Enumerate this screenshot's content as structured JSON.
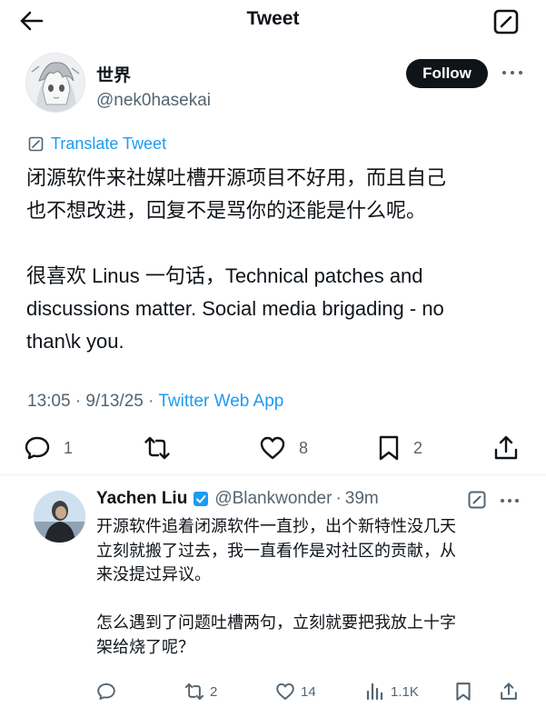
{
  "header": {
    "title": "Tweet"
  },
  "author": {
    "name": "世界",
    "handle": "@nek0hasekai",
    "follow_label": "Follow"
  },
  "translate_label": "Translate Tweet",
  "tweet": {
    "paragraphs": [
      [
        "闭源软件来社媒吐槽开源项目不好用，而且自己",
        "也不想改进，回复不是骂你的还能是什么呢。"
      ],
      [
        "很喜欢 Linus 一句话，Technical patches and",
        "discussions matter. Social media brigading - no",
        "than\\k you."
      ]
    ],
    "time": "13:05 · 9/13/25 · ",
    "source": "Twitter Web App"
  },
  "actions": {
    "replies": "1",
    "retweets": "",
    "likes": "8",
    "bookmarks": "2"
  },
  "reply": {
    "name": "Yachen Liu",
    "handle": "@Blankwonder",
    "separator": "·",
    "time": "39m",
    "paragraphs": [
      [
        "开源软件追着闭源软件一直抄，出个新特性没几天",
        "立刻就搬了过去，我一直看作是对社区的贡献，从",
        "来没提过异议。"
      ],
      [
        "怎么遇到了问题吐槽两句，立刻就要把我放上十字",
        "架给烧了呢？"
      ]
    ],
    "actions": {
      "replies": "",
      "retweets": "2",
      "likes": "14",
      "views": "1.1K"
    }
  },
  "colors": {
    "accent": "#1d9bf0",
    "text": "#0f1419",
    "muted": "#536471",
    "follow_bg": "#0f1419"
  },
  "icons": [
    "back-arrow-icon",
    "compose-icon",
    "more-icon",
    "translate-icon",
    "reply-icon",
    "retweet-icon",
    "like-icon",
    "bookmark-icon",
    "share-icon",
    "verified-icon",
    "views-icon"
  ]
}
